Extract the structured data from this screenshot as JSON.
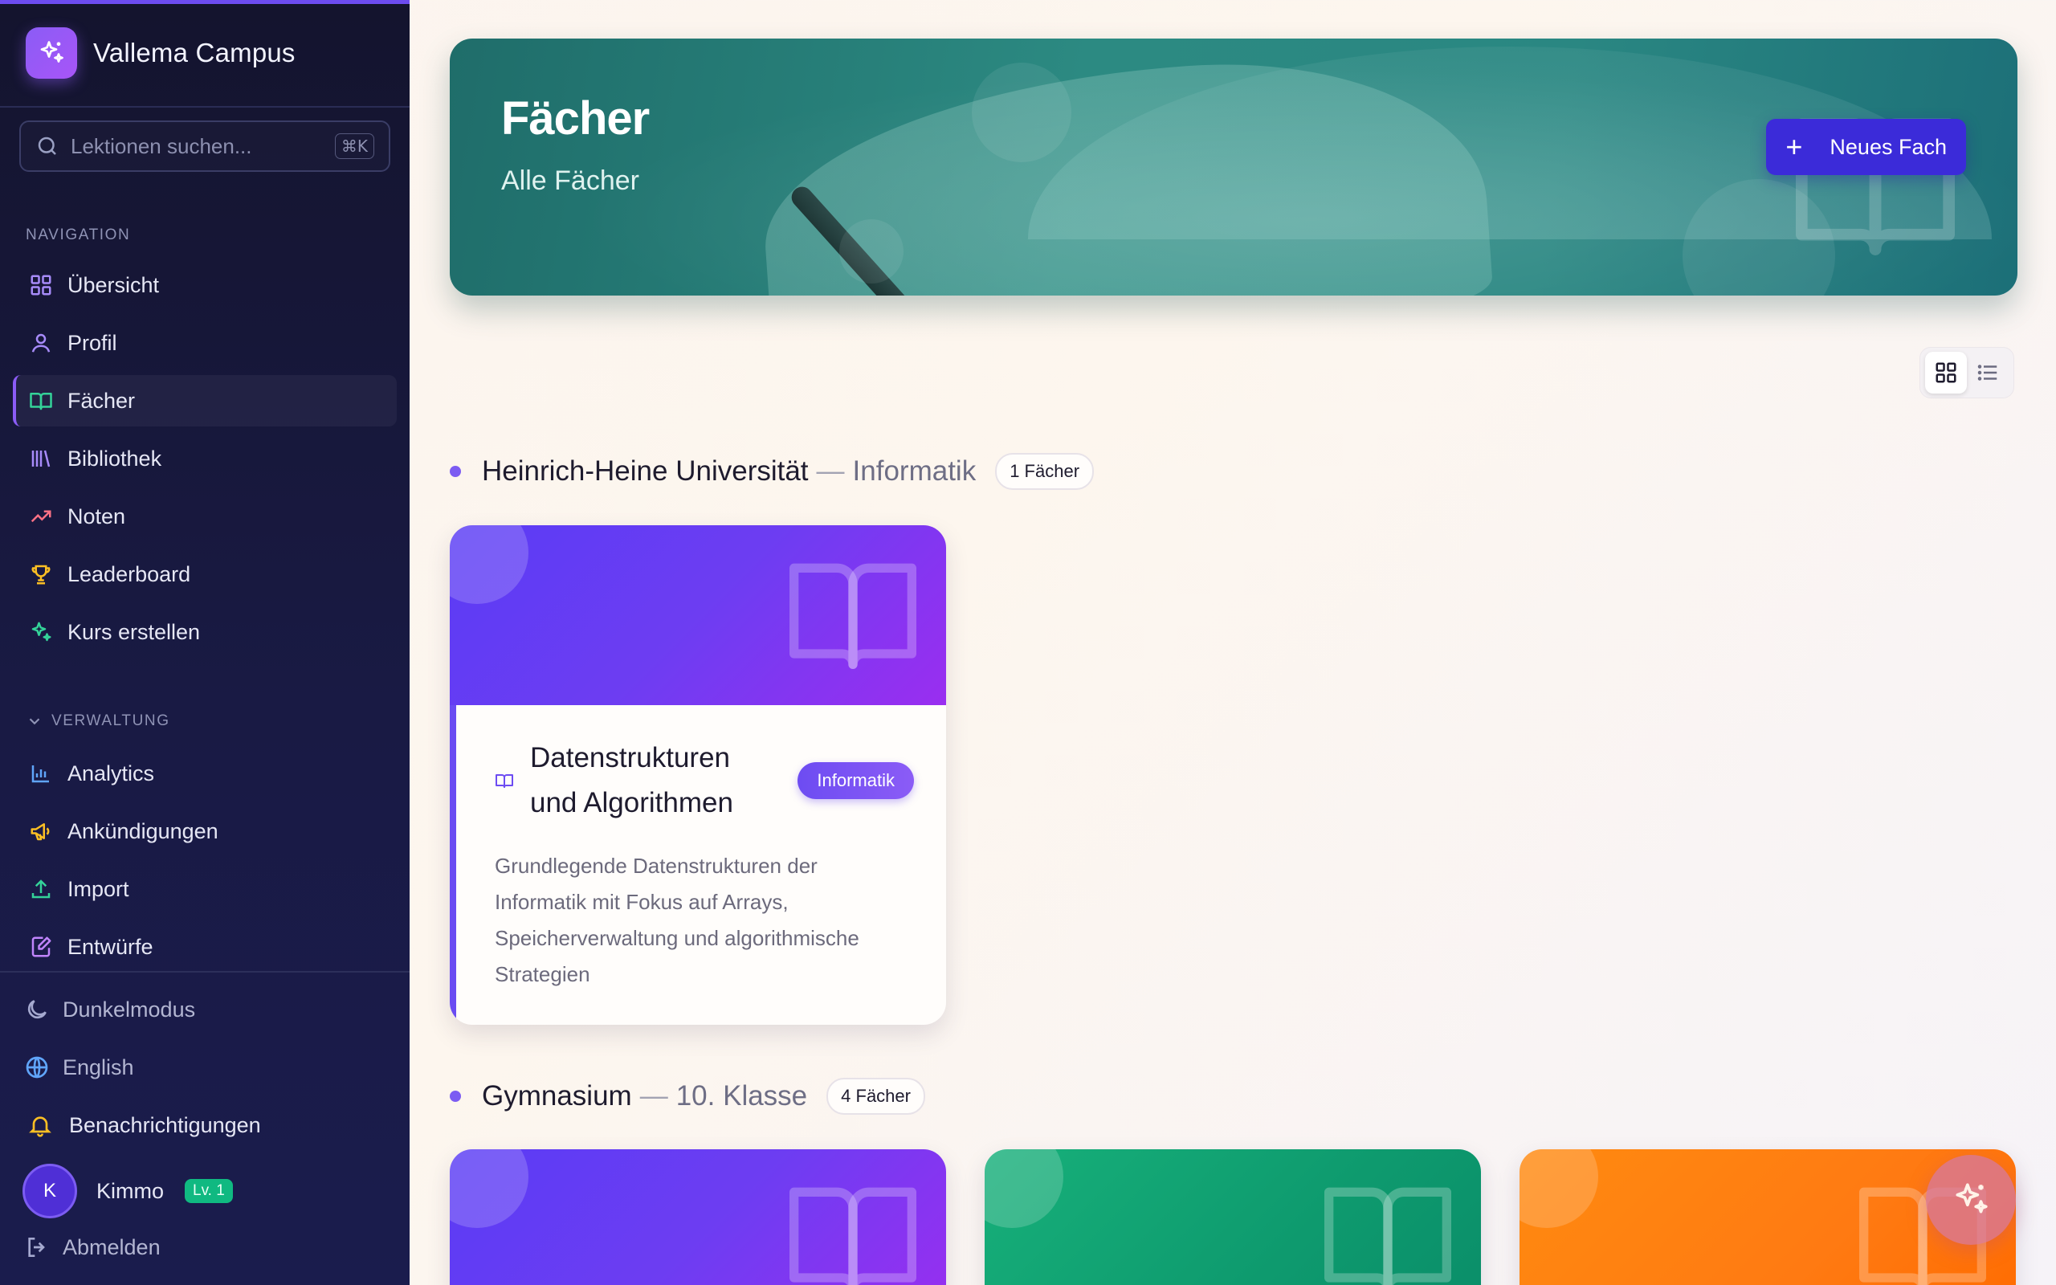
{
  "app": {
    "name": "Vallema Campus",
    "logo_icon": "sparkles-icon",
    "accent": "#6d4cf0"
  },
  "search": {
    "placeholder": "Lektionen suchen...",
    "shortcut": "⌘K"
  },
  "sidebar": {
    "nav_label": "NAVIGATION",
    "nav_items": [
      {
        "label": "Übersicht",
        "icon": "dashboard-icon",
        "color": "#a78bfa"
      },
      {
        "label": "Profil",
        "icon": "user-icon",
        "color": "#a78bfa"
      },
      {
        "label": "Fächer",
        "icon": "book-open-icon",
        "color": "#34d399",
        "active": true
      },
      {
        "label": "Bibliothek",
        "icon": "library-icon",
        "color": "#a78bfa"
      },
      {
        "label": "Noten",
        "icon": "trending-up-icon",
        "color": "#fb7185"
      },
      {
        "label": "Leaderboard",
        "icon": "trophy-icon",
        "color": "#fbbf24"
      },
      {
        "label": "Kurs erstellen",
        "icon": "sparkles-icon",
        "color": "#34d399"
      }
    ],
    "admin_label": "VERWALTUNG",
    "admin_items": [
      {
        "label": "Analytics",
        "icon": "bar-chart-icon",
        "color": "#60a5fa"
      },
      {
        "label": "Ankündigungen",
        "icon": "megaphone-icon",
        "color": "#fbbf24"
      },
      {
        "label": "Import",
        "icon": "upload-icon",
        "color": "#34d399"
      },
      {
        "label": "Entwürfe",
        "icon": "edit-icon",
        "color": "#c084fc"
      }
    ],
    "utility": {
      "dark_mode": "Dunkelmodus",
      "language": "English",
      "notifications": "Benachrichtigungen",
      "logout": "Abmelden"
    },
    "user": {
      "initial": "K",
      "name": "Kimmo",
      "level": "Lv. 1"
    }
  },
  "hero": {
    "title": "Fächer",
    "subtitle": "Alle Fächer",
    "button_label": "Neues Fach"
  },
  "groups": [
    {
      "name": "Heinrich-Heine Universität",
      "sub": "Informatik",
      "count": "1 Fächer",
      "cards": [
        {
          "title": "Datenstrukturen und Algorithmen",
          "tag": "Informatik",
          "description": "Grundlegende Datenstrukturen der Informatik mit Fokus auf Arrays, Speicherverwaltung und algorithmische Strategien",
          "color": "purple"
        }
      ]
    },
    {
      "name": "Gymnasium",
      "sub": "10. Klasse",
      "count": "4 Fächer",
      "cards": [
        {
          "color": "purple"
        },
        {
          "color": "green"
        },
        {
          "color": "orange"
        }
      ]
    }
  ]
}
